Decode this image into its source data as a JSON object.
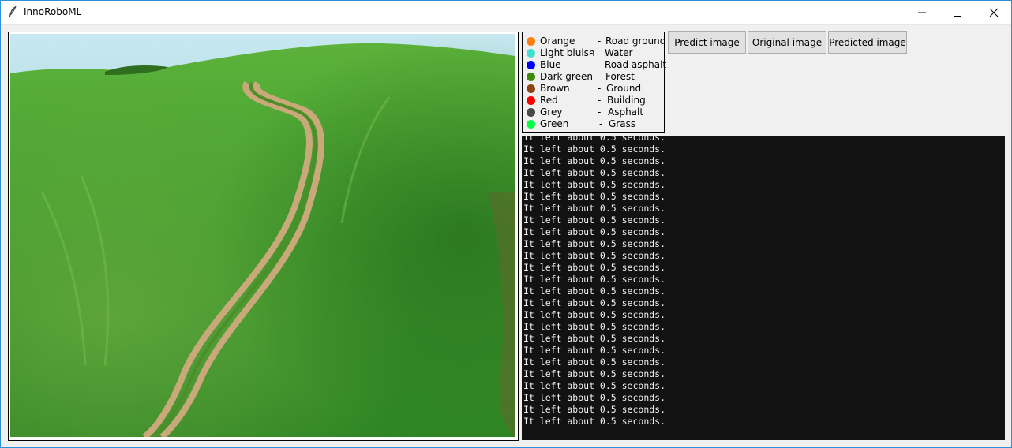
{
  "window": {
    "title": "InnoRoboML",
    "icon": "feather-icon",
    "controls": [
      "minimize-icon",
      "maximize-icon",
      "close-icon"
    ]
  },
  "legend": {
    "items": [
      {
        "color_name": "Orange",
        "class": "Road ground",
        "color": "#ff7f0e"
      },
      {
        "color_name": "Light bluish",
        "class": "Water",
        "color": "#40e0d0"
      },
      {
        "color_name": "Blue",
        "class": "Road asphalt",
        "color": "#0000ff"
      },
      {
        "color_name": "Dark green",
        "class": "Forest",
        "color": "#3c8c0a"
      },
      {
        "color_name": "Brown",
        "class": "Ground",
        "color": "#8b4513"
      },
      {
        "color_name": "Red",
        "class": "Building",
        "color": "#ff0000"
      },
      {
        "color_name": "Grey",
        "class": "Asphalt",
        "color": "#4a4a4a"
      },
      {
        "color_name": "Green",
        "class": "Grass",
        "color": "#00ff40"
      }
    ],
    "separator": "-"
  },
  "toolbar": {
    "predict_label": "Predict image",
    "original_label": "Original image",
    "predicted_label": "Predicted image"
  },
  "console": {
    "lines": [
      "It left about 0.5 seconds.",
      "It left about 0.5 seconds.",
      "It left about 0.5 seconds.",
      "It left about 0.5 seconds.",
      "It left about 0.5 seconds.",
      "It left about 0.5 seconds.",
      "It left about 0.5 seconds.",
      "It left about 0.5 seconds.",
      "It left about 0.5 seconds.",
      "It left about 0.5 seconds.",
      "It left about 0.5 seconds.",
      "It left about 0.5 seconds.",
      "It left about 0.5 seconds.",
      "It left about 0.5 seconds.",
      "It left about 0.5 seconds.",
      "It left about 0.5 seconds.",
      "It left about 0.5 seconds.",
      "It left about 0.5 seconds.",
      "It left about 0.5 seconds.",
      "It left about 0.5 seconds.",
      "It left about 0.5 seconds.",
      "It left about 0.5 seconds.",
      "It left about 0.5 seconds.",
      "It left about 0.5 seconds.",
      "It left about 0.5 seconds."
    ]
  },
  "image": {
    "colors": {
      "sky": "#bfe4ee",
      "water": "#6fb4c6",
      "grass": "#3f9a2c",
      "grass_dark": "#2c7a20",
      "road": "#c9a97a"
    }
  }
}
